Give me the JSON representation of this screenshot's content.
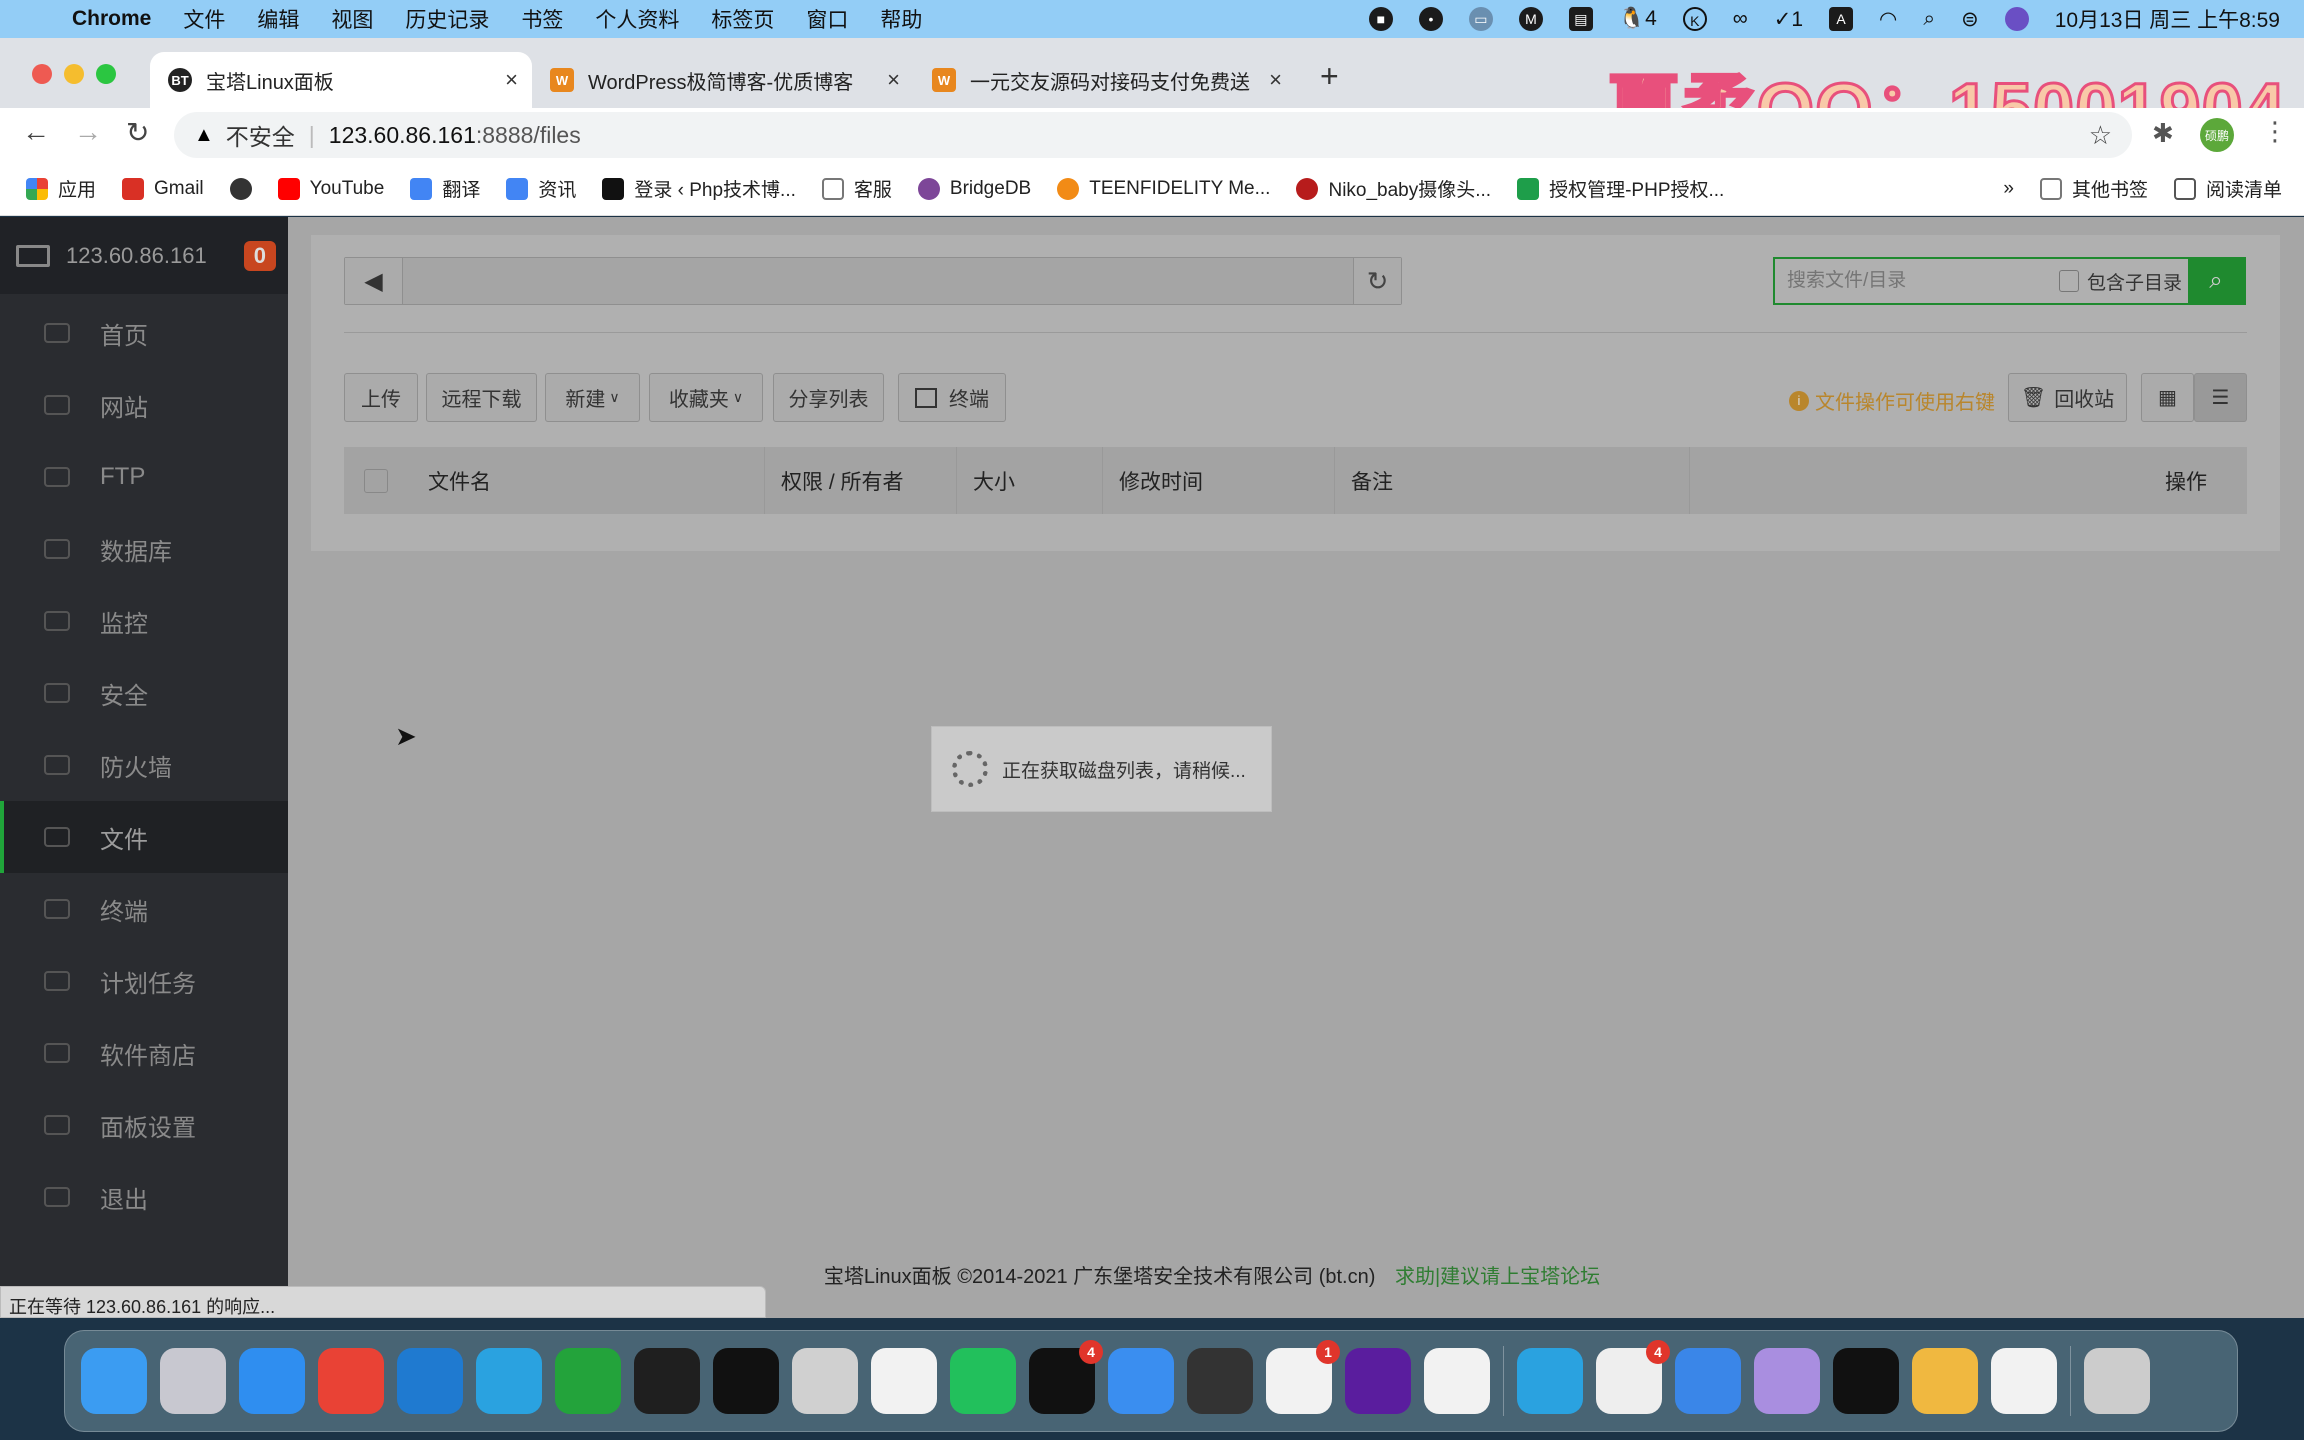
{
  "menubar": {
    "app": "Chrome",
    "items": [
      "文件",
      "编辑",
      "视图",
      "历史记录",
      "书签",
      "个人资料",
      "标签页",
      "窗口",
      "帮助"
    ],
    "qq_count": "4",
    "todo_count": "1",
    "clock": "10月13日 周三 上午8:59"
  },
  "tabs": [
    {
      "title": "宝塔Linux面板",
      "favicon": "BT",
      "active": true
    },
    {
      "title": "WordPress极简博客-优质博客",
      "favicon": "W"
    },
    {
      "title": "一元交友源码对接码支付免费送",
      "favicon": "W"
    }
  ],
  "address": {
    "security": "不安全",
    "url_host": "123.60.86.161",
    "url_rest": ":8888/files",
    "profile": "硕鹏"
  },
  "bookmarks": [
    {
      "label": "应用",
      "color": "#e94235"
    },
    {
      "label": "Gmail",
      "color": "#d93025"
    },
    {
      "label": "",
      "color": "#333"
    },
    {
      "label": "YouTube",
      "color": "#ff0000"
    },
    {
      "label": "翻译",
      "color": "#4285f4"
    },
    {
      "label": "资讯",
      "color": "#4285f4"
    },
    {
      "label": "登录 ‹ Php技术博...",
      "color": "#111"
    },
    {
      "label": "客服",
      "color": "#888"
    },
    {
      "label": "BridgeDB",
      "color": "#7d4698"
    },
    {
      "label": "TEENFIDELITY Me...",
      "color": "#f28b16"
    },
    {
      "label": "Niko_baby摄像头...",
      "color": "#b71c1c"
    },
    {
      "label": "授权管理-PHP授权...",
      "color": "#1e9e4a"
    }
  ],
  "bookmarks_more": "»",
  "other_bookmarks": "其他书签",
  "reading_list": "阅读清单",
  "watermark": "夏柔QQ：15001904",
  "sidebar": {
    "host": "123.60.86.161",
    "badge": "0",
    "items": [
      {
        "label": "首页"
      },
      {
        "label": "网站"
      },
      {
        "label": "FTP"
      },
      {
        "label": "数据库"
      },
      {
        "label": "监控"
      },
      {
        "label": "安全"
      },
      {
        "label": "防火墙"
      },
      {
        "label": "文件",
        "active": true
      },
      {
        "label": "终端"
      },
      {
        "label": "计划任务"
      },
      {
        "label": "软件商店"
      },
      {
        "label": "面板设置"
      },
      {
        "label": "退出"
      }
    ]
  },
  "files": {
    "search_placeholder": "搜索文件/目录",
    "include_subdir": "包含子目录",
    "buttons": [
      "上传",
      "远程下载",
      "新建",
      "收藏夹",
      "分享列表",
      "终端"
    ],
    "hint": "文件操作可使用右键",
    "recycle": "回收站",
    "columns": [
      "文件名",
      "权限 / 所有者",
      "大小",
      "修改时间",
      "备注",
      "操作"
    ]
  },
  "loading": "正在获取磁盘列表，请稍候...",
  "footer": {
    "copyright": "宝塔Linux面板 ©2014-2021 广东堡塔安全技术有限公司 (bt.cn)",
    "link": "求助|建议请上宝塔论坛"
  },
  "status": "正在等待 123.60.86.161 的响应...",
  "colors": {
    "accent": "#20a53a",
    "badge": "#c8461f",
    "hint": "#b9862c"
  },
  "dock": [
    {
      "icon": "finder",
      "color": "#3b9cf2"
    },
    {
      "icon": "launchpad",
      "color": "#c8c8d0"
    },
    {
      "icon": "safari",
      "color": "#2f8ef0"
    },
    {
      "icon": "chrome",
      "color": "#e94235"
    },
    {
      "icon": "vscode",
      "color": "#1f7ad0"
    },
    {
      "icon": "a-app",
      "color": "#2aa2e0"
    },
    {
      "icon": "h-app",
      "color": "#23a33b"
    },
    {
      "icon": "pycharm",
      "color": "#1f1f1f"
    },
    {
      "icon": "clion",
      "color": "#111"
    },
    {
      "icon": "messages",
      "color": "#d0d0d0"
    },
    {
      "icon": "baidu-netdisk",
      "color": "#f2f2f2"
    },
    {
      "icon": "wechat",
      "color": "#22c05c"
    },
    {
      "icon": "qq",
      "color": "#111",
      "badge": "4"
    },
    {
      "icon": "feishu",
      "color": "#3a8ef0"
    },
    {
      "icon": "zen-terminal",
      "color": "#333"
    },
    {
      "icon": "tick-tick",
      "color": "#f2f2f2",
      "badge": "1"
    },
    {
      "icon": "podcast",
      "color": "#5a1d9e"
    },
    {
      "icon": "g-app",
      "color": "#f2f2f2"
    },
    {
      "icon": "video-player",
      "color": "#2aa2e0"
    },
    {
      "icon": "m-mail",
      "color": "#eee",
      "badge": "4"
    },
    {
      "icon": "k-app",
      "color": "#3a86e8"
    },
    {
      "icon": "b-app",
      "color": "#a98ee0"
    },
    {
      "icon": "capcut",
      "color": "#111"
    },
    {
      "icon": "archive",
      "color": "#f0b840"
    },
    {
      "icon": "textedit",
      "color": "#f2f2f2"
    },
    {
      "icon": "trash",
      "color": "#ccc"
    }
  ]
}
